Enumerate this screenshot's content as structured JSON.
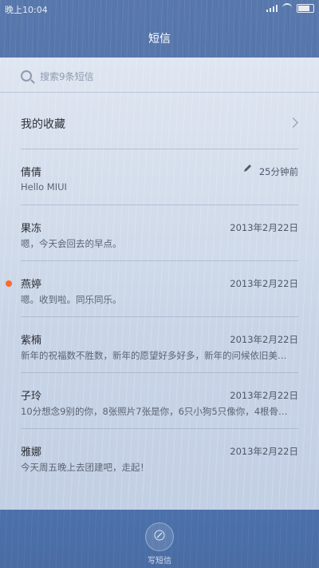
{
  "status_bar": {
    "time": "晚上10:04"
  },
  "header": {
    "title": "短信"
  },
  "search": {
    "placeholder": "搜索9条短信"
  },
  "favorites": {
    "label": "我的收藏"
  },
  "conversations": [
    {
      "name": "倩倩",
      "preview": "Hello MIUI",
      "time": "25分钟前",
      "draft": true,
      "unread": false
    },
    {
      "name": "果冻",
      "preview": "嗯，今天会回去的早点。",
      "time": "2013年2月22日",
      "draft": false,
      "unread": false
    },
    {
      "name": "燕婷",
      "preview": "嗯。收到啦。同乐同乐。",
      "time": "2013年2月22日",
      "draft": false,
      "unread": true
    },
    {
      "name": "紫楠",
      "preview": "新年的祝福数不胜数，新年的愿望好多好多，新年的问候依旧美…",
      "time": "2013年2月22日",
      "draft": false,
      "unread": false
    },
    {
      "name": "子玲",
      "preview": "10分想念9别的你，8张照片7张是你，6只小狗5只像你，4根骨…",
      "time": "2013年2月22日",
      "draft": false,
      "unread": false
    },
    {
      "name": "雅娜",
      "preview": "今天周五晚上去团建吧，走起！",
      "time": "2013年2月22日",
      "draft": false,
      "unread": false
    }
  ],
  "bottom_bar": {
    "compose_label": "写短信"
  },
  "colors": {
    "unread_dot": "#ff6a2a",
    "accent_blue": "#4b71ab"
  },
  "icons": {
    "search": "search-icon",
    "favorites_arrow": "chevron-right-icon",
    "draft": "pencil-icon",
    "compose": "compose-icon"
  }
}
